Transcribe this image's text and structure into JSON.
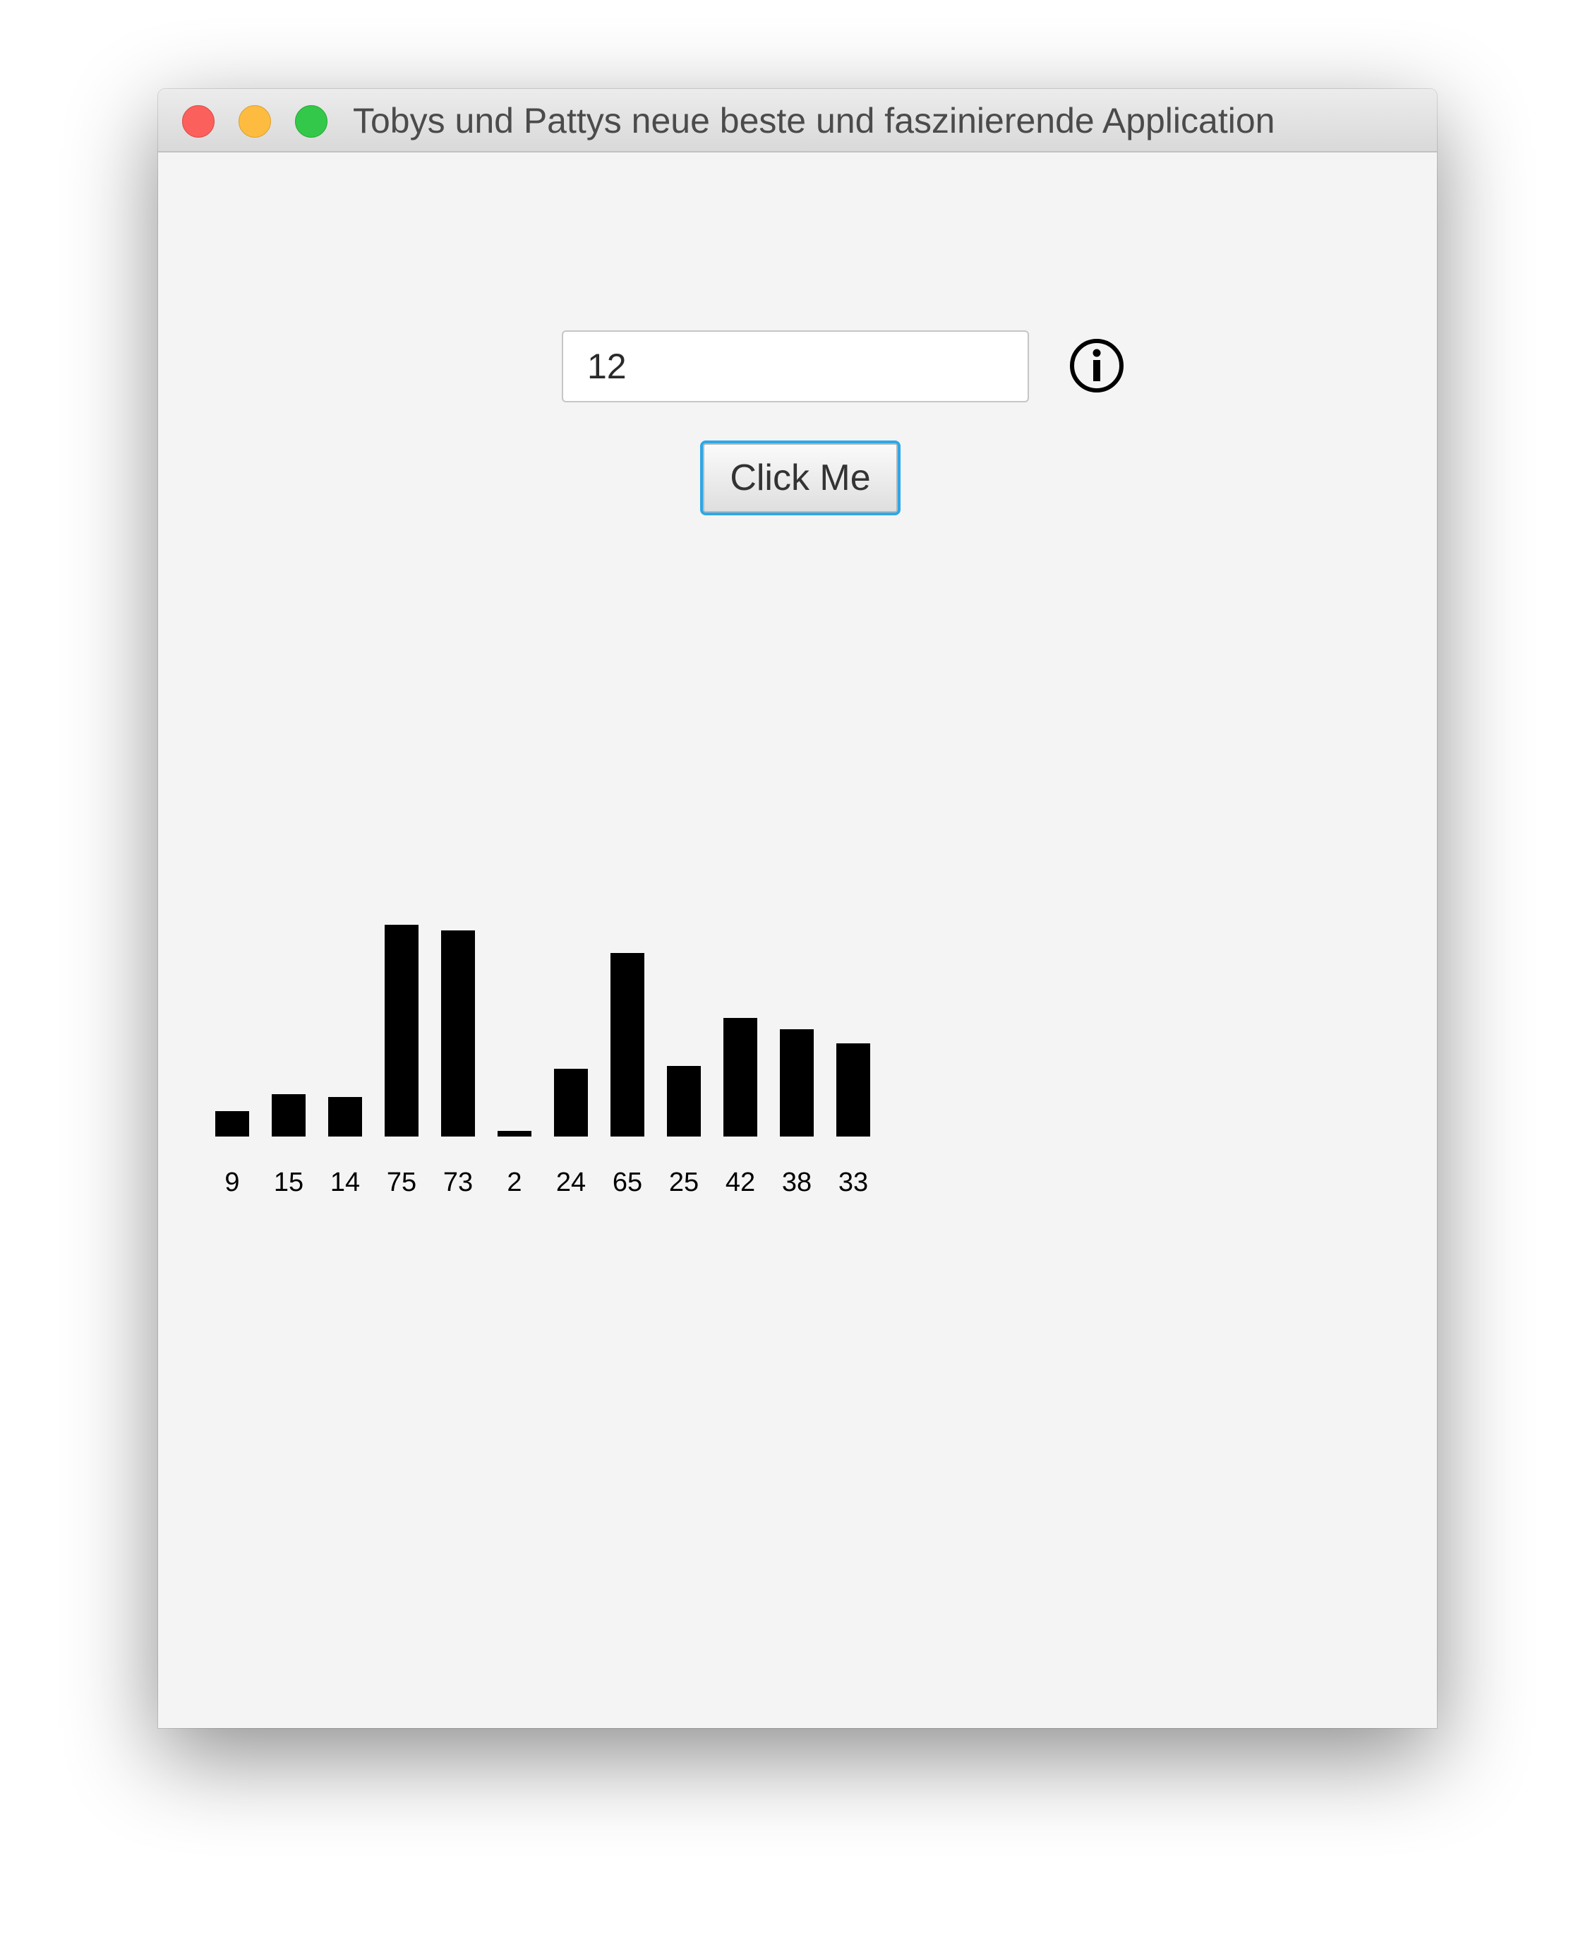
{
  "window": {
    "title": "Tobys und Pattys neue beste und faszinierende Application"
  },
  "input": {
    "value": "12"
  },
  "button": {
    "label": "Click Me"
  },
  "icons": {
    "info": "info-icon"
  },
  "colors": {
    "bar": "#000000",
    "button_focus_ring": "#2ea7e6",
    "close": "#fc605c",
    "minimize": "#fdbc40",
    "maximize": "#34c84a"
  },
  "chart_data": {
    "type": "bar",
    "categories": [
      "9",
      "15",
      "14",
      "75",
      "73",
      "2",
      "24",
      "65",
      "25",
      "42",
      "38",
      "33"
    ],
    "values": [
      9,
      15,
      14,
      75,
      73,
      2,
      24,
      65,
      25,
      42,
      38,
      33
    ],
    "title": "",
    "xlabel": "",
    "ylabel": "",
    "grid": false,
    "legend": "none"
  }
}
